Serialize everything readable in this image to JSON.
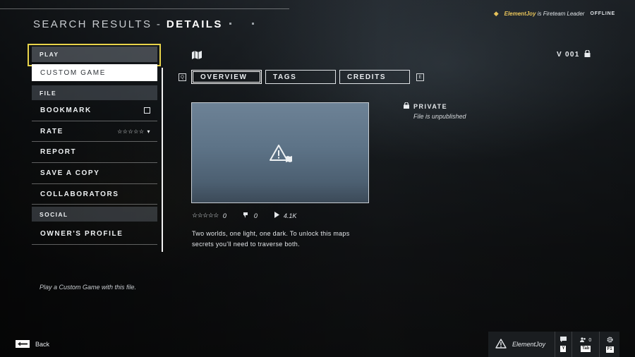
{
  "header": {
    "title_prefix": "SEARCH RESULTS -",
    "title_main": "DETAILS",
    "player_name": "ElementJoy",
    "player_suffix": "is Fireteam Leader",
    "status": "OFFLINE"
  },
  "menu": {
    "play_section": "PLAY",
    "custom_game": "CUSTOM GAME",
    "file_section": "FILE",
    "bookmark": "BOOKMARK",
    "rate": "RATE",
    "rate_value": "☆☆☆☆☆",
    "report": "REPORT",
    "save_copy": "SAVE A COPY",
    "collaborators": "COLLABORATORS",
    "social_section": "SOCIAL",
    "owners_profile": "OWNER'S PROFILE",
    "hint": "Play a Custom Game with this file."
  },
  "detail": {
    "version": "V 001",
    "nav_left_key": "Q",
    "nav_right_key": "E",
    "tabs": [
      "OVERVIEW",
      "TAGS",
      "CREDITS"
    ],
    "active_tab": "OVERVIEW",
    "rating_stars": "☆☆☆☆☆",
    "rating_count": "0",
    "likes": "0",
    "plays": "4.1K",
    "description": "Two worlds, one light, one dark. To unlock this maps secrets you'll need to traverse both.",
    "privacy_title": "PRIVATE",
    "privacy_subtitle": "File is unpublished"
  },
  "footer": {
    "back_label": "Back",
    "dock_user": "ElementJoy",
    "chat_key": "Y",
    "fireteam_count": "0",
    "fireteam_key": "Tab",
    "settings_key": "F1"
  },
  "colors": {
    "focus_yellow": "#e8d34a",
    "leader_gold": "#e7c35a",
    "thumb_blue": "#5d7387"
  },
  "icons": [
    "map-icon",
    "lock-icon",
    "warning-icon",
    "like-icon",
    "play-icon",
    "chat-icon",
    "fireteam-icon",
    "gear-icon",
    "back-arrow-icon"
  ]
}
